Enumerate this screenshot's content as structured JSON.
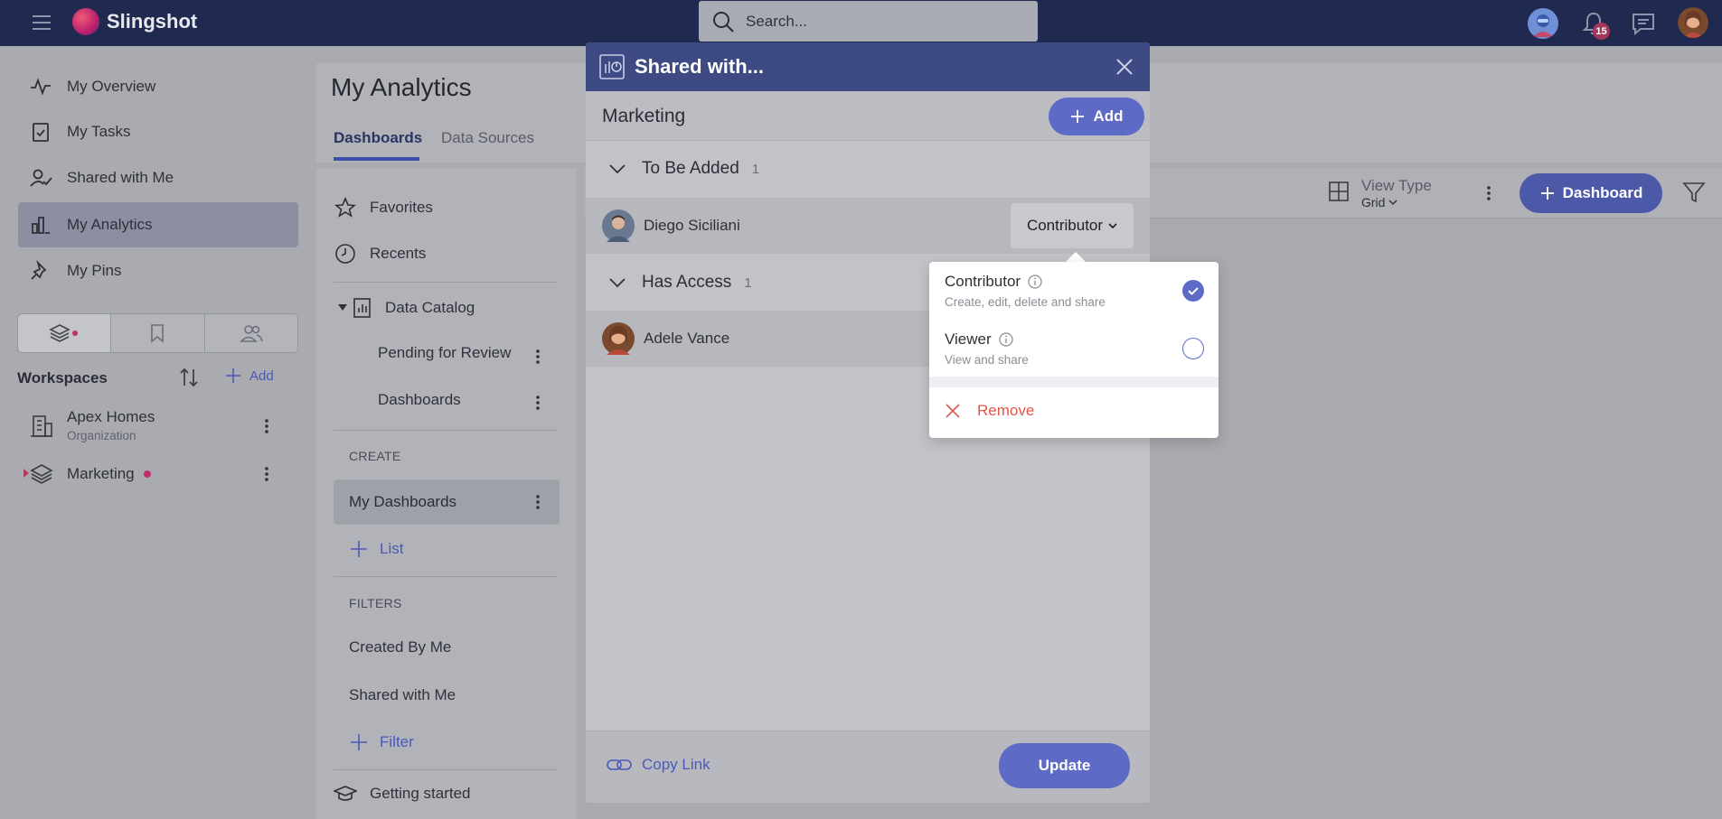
{
  "app": {
    "name": "Slingshot"
  },
  "topbar": {
    "search_placeholder": "Search...",
    "notification_count": "15"
  },
  "nav": {
    "items": [
      {
        "label": "My Overview",
        "icon": "pulse-icon"
      },
      {
        "label": "My Tasks",
        "icon": "clipboard-check-icon"
      },
      {
        "label": "Shared with Me",
        "icon": "user-check-icon"
      },
      {
        "label": "My Analytics",
        "icon": "bar-chart-icon",
        "active": true
      },
      {
        "label": "My Pins",
        "icon": "pin-icon"
      }
    ],
    "workspaces_title": "Workspaces",
    "add_label": "Add",
    "workspaces": [
      {
        "name": "Apex Homes",
        "sub": "Organization"
      },
      {
        "name": "Marketing",
        "sub": ""
      }
    ]
  },
  "main": {
    "title": "My Analytics",
    "tabs": [
      {
        "label": "Dashboards",
        "active": true
      },
      {
        "label": "Data Sources",
        "active": false
      }
    ]
  },
  "sidebar2": {
    "favorites": "Favorites",
    "recents": "Recents",
    "data_catalog": "Data Catalog",
    "pending": "Pending for Review",
    "dashboards": "Dashboards",
    "create_section": "CREATE",
    "my_dashboards": "My Dashboards",
    "list": "List",
    "filters_section": "FILTERS",
    "created_by_me": "Created By Me",
    "shared_with_me": "Shared with Me",
    "filter": "Filter",
    "getting_started": "Getting started"
  },
  "toolbar": {
    "view_type_label": "View Type",
    "view_type_value": "Grid",
    "dashboard_button": "Dashboard"
  },
  "modal": {
    "title": "Shared with...",
    "workspace": "Marketing",
    "add_button": "Add",
    "groups": [
      {
        "title": "To Be Added",
        "count": "1"
      },
      {
        "title": "Has Access",
        "count": "1"
      }
    ],
    "to_be_added": {
      "name": "Diego Siciliani",
      "role": "Contributor"
    },
    "has_access": {
      "name": "Adele Vance"
    },
    "copy_link": "Copy Link",
    "update_button": "Update"
  },
  "role_popup": {
    "options": [
      {
        "title": "Contributor",
        "desc": "Create, edit, delete and share",
        "selected": true
      },
      {
        "title": "Viewer",
        "desc": "View and share",
        "selected": false
      }
    ],
    "remove": "Remove"
  },
  "colors": {
    "topbar": "#20294f",
    "accent": "#5d6ac6",
    "modal_header": "#3d4a83",
    "remove": "#e2564c",
    "marketing_dot": "#c0306a"
  }
}
